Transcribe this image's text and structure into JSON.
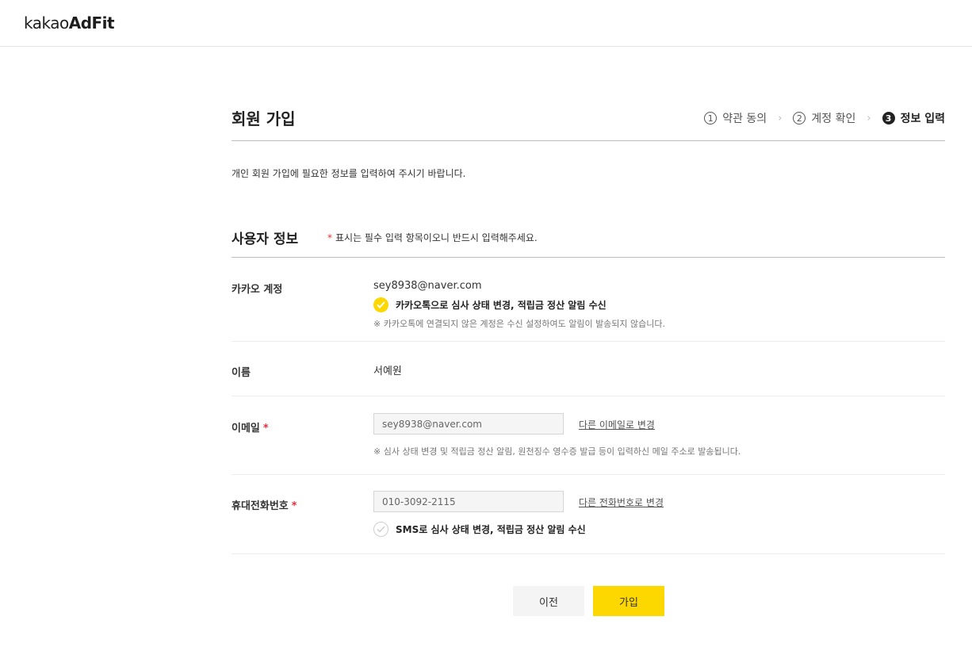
{
  "header": {
    "logo_light": "kakao",
    "logo_bold": "AdFit"
  },
  "page": {
    "title": "회원 가입",
    "description": "개인 회원 가입에 필요한 정보를 입력하여 주시기 바랍니다."
  },
  "steps": [
    {
      "num": "1",
      "label": "약관 동의"
    },
    {
      "num": "2",
      "label": "계정 확인"
    },
    {
      "num": "3",
      "label": "정보 입력"
    }
  ],
  "section": {
    "title": "사용자 정보",
    "required_star": "*",
    "required_note": "표시는 필수 입력 항목이오니 반드시 입력해주세요."
  },
  "kakao_account": {
    "label": "카카오 계정",
    "value": "sey8938@naver.com",
    "notify_label": "카카오톡으로 심사 상태 변경, 적립금 정산 알림 수신",
    "notify_checked": true,
    "note": "※ 카카오톡에 연결되지 않은 계정은 수신 설정하여도 알림이 발송되지 않습니다."
  },
  "name": {
    "label": "이름",
    "value": "서예원"
  },
  "email": {
    "label": "이메일",
    "required": "*",
    "value": "sey8938@naver.com",
    "change_link": "다른 이메일로 변경",
    "note": "※ 심사 상태 변경 및 적립금 정산 알림, 원천징수 영수증 발급 등이 입력하신 메일 주소로 발송됩니다."
  },
  "phone": {
    "label": "휴대전화번호",
    "required": "*",
    "value": "010-3092-2115",
    "change_link": "다른 전화번호로 변경",
    "sms_label": "SMS로 심사 상태 변경, 적립금 정산 알림 수신",
    "sms_checked": false
  },
  "buttons": {
    "prev": "이전",
    "join": "가입"
  },
  "colors": {
    "accent": "#fcd700",
    "required": "#e0313b"
  }
}
